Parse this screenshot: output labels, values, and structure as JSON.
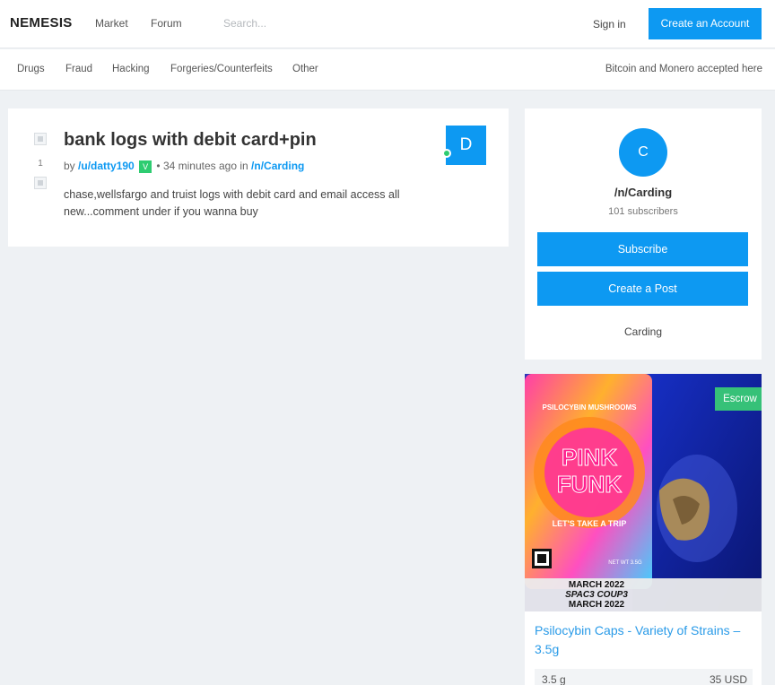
{
  "header": {
    "logo": "NEMESIS",
    "nav": [
      "Market",
      "Forum"
    ],
    "search_placeholder": "Search...",
    "signin_label": "Sign in",
    "create_account_label": "Create an Account"
  },
  "categories": {
    "items": [
      "Drugs",
      "Fraud",
      "Hacking",
      "Forgeries/Counterfeits",
      "Other"
    ],
    "accepted_note": "Bitcoin and Monero accepted here"
  },
  "post": {
    "title": "bank logs with debit card+pin",
    "votes": "1",
    "by_label": "by",
    "author": "/u/datty190",
    "verified_badge": "V",
    "time": "• 34 minutes ago in",
    "community": "/n/Carding",
    "body": "chase,wellsfargo and truist logs with debit card and email access all new...comment under if you wanna buy",
    "author_avatar_letter": "D"
  },
  "community": {
    "avatar_letter": "C",
    "name": "/n/Carding",
    "subscribers": "101 subscribers",
    "subscribe_label": "Subscribe",
    "create_post_label": "Create a Post",
    "description": "Carding"
  },
  "product": {
    "escrow_label": "Escrow",
    "title": "Psilocybin Caps - Variety of Strains – 3.5g",
    "quantity": "3.5 g",
    "price": "35 USD",
    "image_text": {
      "brand_top": "PSILOCYBIN MUSHROOMS",
      "brand_line1": "PINK",
      "brand_line2": "FUNK",
      "tagline": "LET'S TAKE A TRIP",
      "net_wt": "NET WT 3.5G",
      "label1": "MARCH 2022",
      "label2": "SPAC3 COUP3",
      "label3": "MARCH 2022"
    }
  },
  "colors": {
    "accent": "#0d99f2",
    "success": "#2ecc71",
    "escrow": "#36c178",
    "background": "#eef1f4"
  }
}
